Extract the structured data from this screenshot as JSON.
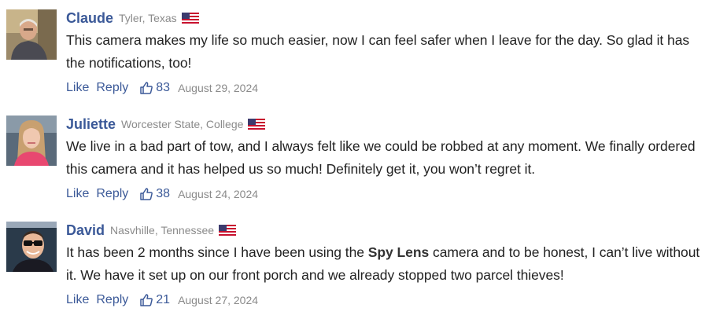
{
  "comments": [
    {
      "name": "Claude",
      "location": "Tyler, Texas",
      "text": "This camera makes my life so much easier, now I can feel safer when I leave for the day. So glad it has the notifications, too!",
      "like_label": "Like",
      "reply_label": "Reply",
      "likes": "83",
      "date": "August 29, 2024",
      "avatar_icon": "elderly-man-avatar",
      "flag_icon": "us-flag-icon"
    },
    {
      "name": "Juliette",
      "location": "Worcester State, College",
      "text": "We live in a bad part of tow, and I always felt like we could be robbed at any moment. We finally ordered this camera and it has helped us so much! Definitely get it, you won’t regret it.",
      "like_label": "Like",
      "reply_label": "Reply",
      "likes": "38",
      "date": "August 24, 2024",
      "avatar_icon": "young-woman-avatar",
      "flag_icon": "us-flag-icon"
    },
    {
      "name": "David",
      "location": "Nasvhille, Tennessee",
      "text_before": "It has been 2 months since I have been using the ",
      "text_brand": "Spy Lens",
      "text_after": " camera and to be honest, I can’t live without it. We have it set up on our front porch and we already stopped two parcel thieves!",
      "like_label": "Like",
      "reply_label": "Reply",
      "likes": "21",
      "date": "August 27, 2024",
      "avatar_icon": "man-sunglasses-avatar",
      "flag_icon": "us-flag-icon"
    }
  ],
  "colors": {
    "name": "#3b5998",
    "link": "#3b5998",
    "meta": "#8a8a8a",
    "text": "#222222"
  }
}
